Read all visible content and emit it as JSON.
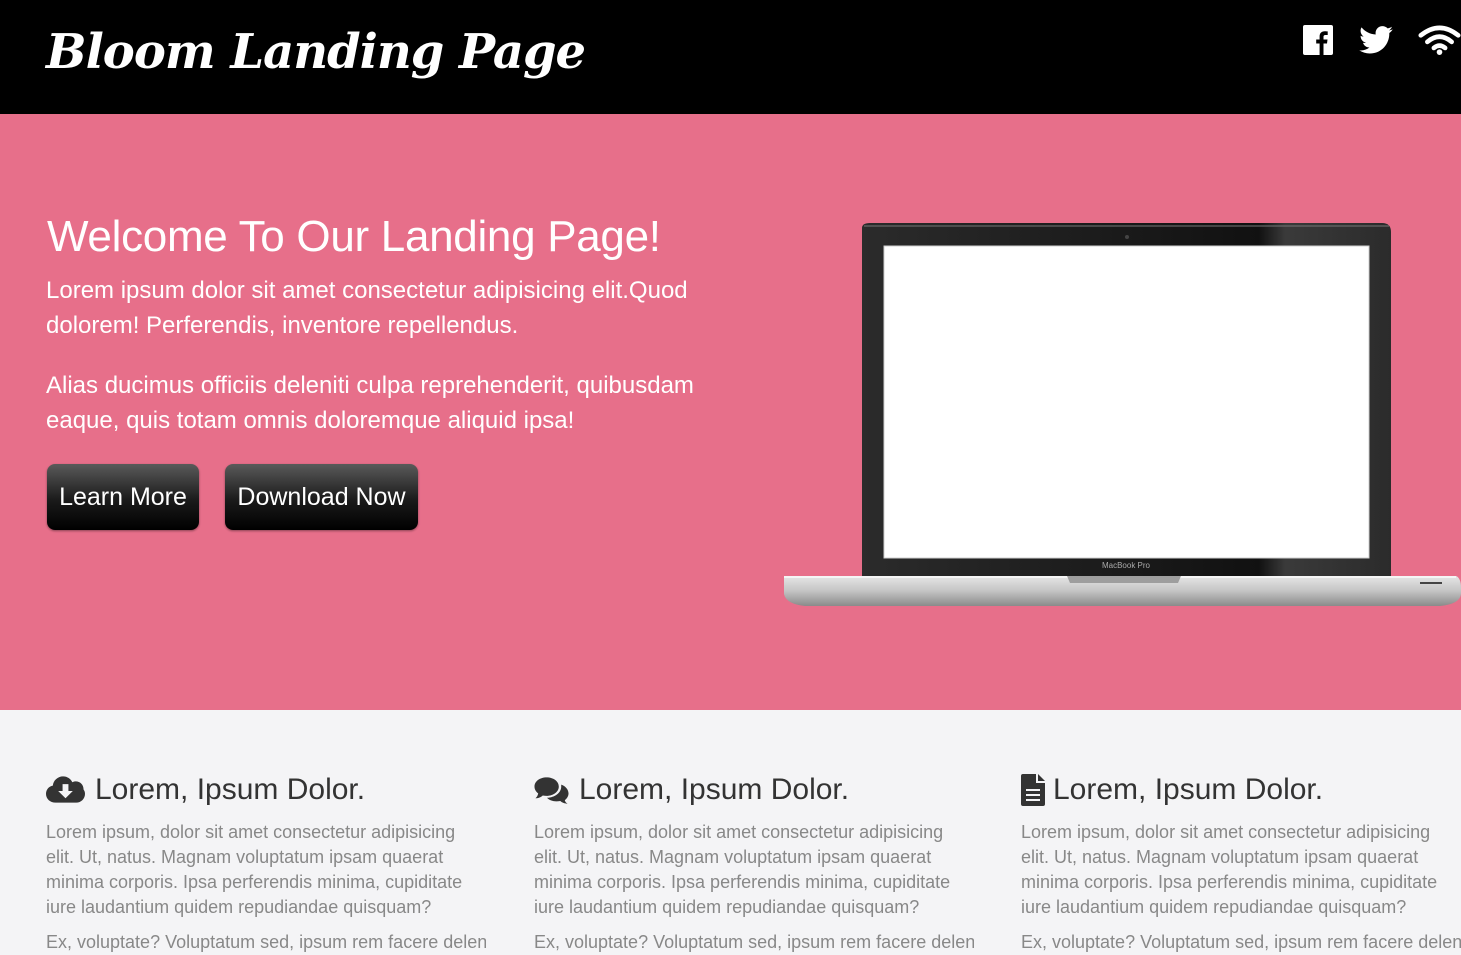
{
  "header": {
    "logo_text": "Bloom Landing Page",
    "social_icons": [
      "facebook-icon",
      "twitter-icon",
      "wifi-icon"
    ]
  },
  "hero": {
    "title": "Welcome To Our Landing Page!",
    "paragraph1": "Lorem ipsum dolor sit amet consectetur adipisicing elit.Quod dolorem! Perferendis, inventore repellendus.",
    "paragraph2": "Alias ducimus officiis deleniti culpa reprehenderit, quibusdam eaque, quis totam omnis doloremque aliquid ipsa!",
    "learn_more_label": "Learn More",
    "download_label": "Download Now",
    "laptop_caption": "MacBook Pro"
  },
  "features": [
    {
      "icon": "cloud-download-icon",
      "title": "Lorem, Ipsum Dolor.",
      "desc1": "Lorem ipsum, dolor sit amet consectetur adipisicing elit. Ut, natus. Magnam voluptatum ipsam quaerat minima corporis. Ipsa perferendis minima, cupiditate iure laudantium quidem repudiandae quisquam?",
      "desc2": "Ex, voluptate? Voluptatum sed, ipsum rem facere deleniti"
    },
    {
      "icon": "comments-icon",
      "title": "Lorem, Ipsum Dolor.",
      "desc1": "Lorem ipsum, dolor sit amet consectetur adipisicing elit. Ut, natus. Magnam voluptatum ipsam quaerat minima corporis. Ipsa perferendis minima, cupiditate iure laudantium quidem repudiandae quisquam?",
      "desc2": "Ex, voluptate? Voluptatum sed, ipsum rem facere deleniti"
    },
    {
      "icon": "file-text-icon",
      "title": "Lorem, Ipsum Dolor.",
      "desc1": "Lorem ipsum, dolor sit amet consectetur adipisicing elit. Ut, natus. Magnam voluptatum ipsam quaerat minima corporis. Ipsa perferendis minima, cupiditate iure laudantium quidem repudiandae quisquam?",
      "desc2": "Ex, voluptate? Voluptatum sed, ipsum rem facere deleniti"
    }
  ],
  "colors": {
    "header_bg": "#000000",
    "hero_bg": "#e76f8a",
    "features_bg": "#f4f4f6",
    "text_gray": "#888888"
  }
}
